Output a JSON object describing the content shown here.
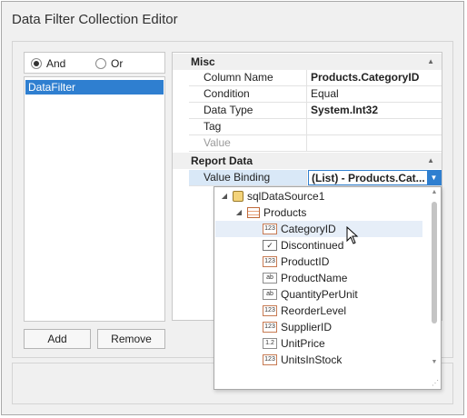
{
  "window": {
    "title": "Data Filter Collection Editor"
  },
  "operators": [
    {
      "label": "And",
      "checked": true
    },
    {
      "label": "Or",
      "checked": false
    }
  ],
  "filters": [
    {
      "label": "DataFilter",
      "selected": true
    }
  ],
  "buttons": {
    "add": "Add",
    "remove": "Remove"
  },
  "property_grid": {
    "misc": {
      "label": "Misc",
      "rows": [
        {
          "name": "Column Name",
          "value": "Products.CategoryID",
          "bold": true
        },
        {
          "name": "Condition",
          "value": "Equal",
          "bold": false
        },
        {
          "name": "Data Type",
          "value": "System.Int32",
          "bold": true
        },
        {
          "name": "Tag",
          "value": "",
          "bold": false
        },
        {
          "name": "Value",
          "value": "",
          "bold": false,
          "disabled": true
        }
      ]
    },
    "report_data": {
      "label": "Report Data",
      "rows": [
        {
          "name": "Value Binding",
          "value": "(List) - Products.Cat..."
        }
      ]
    }
  },
  "tree": {
    "datasource": "sqlDataSource1",
    "table": "Products",
    "fields": [
      {
        "name": "CategoryID",
        "icon": "123",
        "hover": true
      },
      {
        "name": "Discontinued",
        "icon": "✓"
      },
      {
        "name": "ProductID",
        "icon": "123"
      },
      {
        "name": "ProductName",
        "icon": "ab"
      },
      {
        "name": "QuantityPerUnit",
        "icon": "ab"
      },
      {
        "name": "ReorderLevel",
        "icon": "123"
      },
      {
        "name": "SupplierID",
        "icon": "123"
      },
      {
        "name": "UnitPrice",
        "icon": "1.2"
      },
      {
        "name": "UnitsInStock",
        "icon": "123"
      }
    ]
  },
  "colors": {
    "accent": "#2f7fd0",
    "hover": "#e6eef8"
  }
}
